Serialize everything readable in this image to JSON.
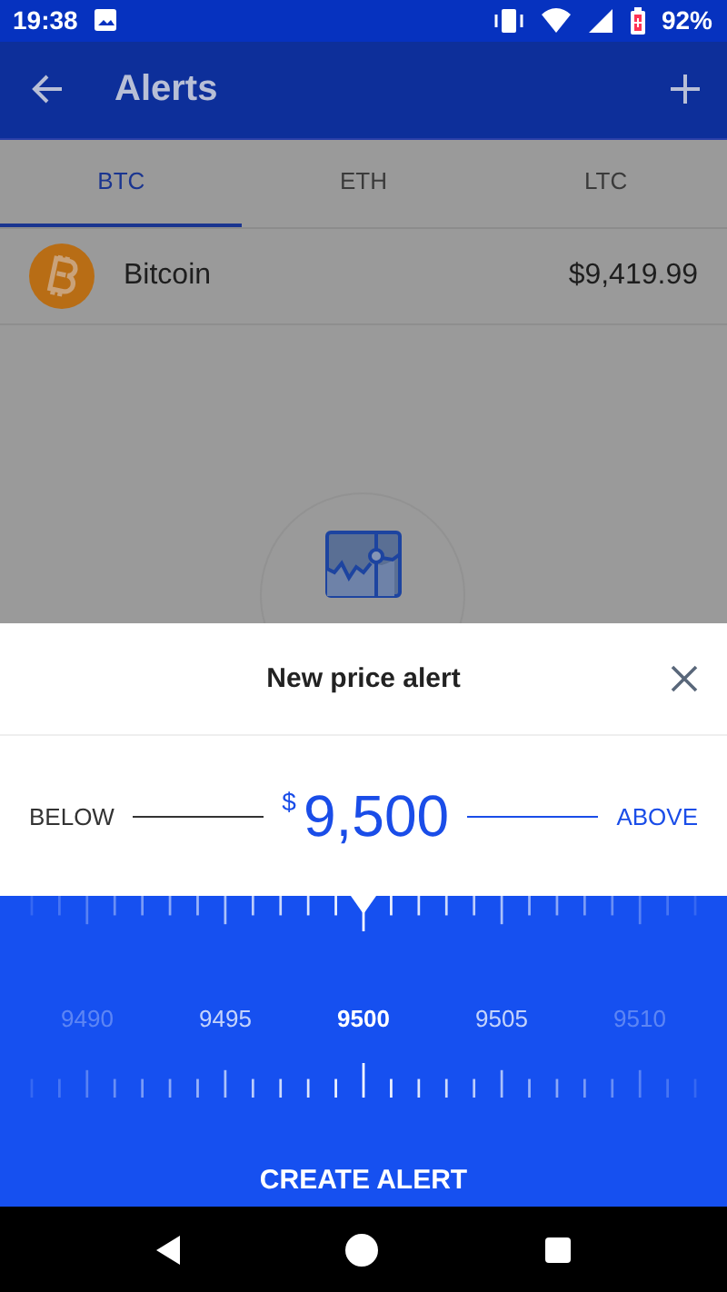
{
  "status_bar": {
    "time": "19:38",
    "battery": "92%"
  },
  "app_bar": {
    "title": "Alerts"
  },
  "tabs": [
    {
      "label": "BTC",
      "selected": true
    },
    {
      "label": "ETH",
      "selected": false
    },
    {
      "label": "LTC",
      "selected": false
    }
  ],
  "coin": {
    "name": "Bitcoin",
    "price": "$9,419.99"
  },
  "sheet": {
    "title": "New price alert",
    "currency": "$",
    "value": "9,500",
    "directions": [
      {
        "label": "BELOW",
        "selected": false
      },
      {
        "label": "ABOVE",
        "selected": true
      }
    ],
    "ruler_labels": [
      {
        "label": "9490",
        "selected": false
      },
      {
        "label": "9495",
        "selected": false
      },
      {
        "label": "9500",
        "selected": true
      },
      {
        "label": "9505",
        "selected": false
      },
      {
        "label": "9510",
        "selected": false
      }
    ],
    "button": "CREATE ALERT"
  }
}
